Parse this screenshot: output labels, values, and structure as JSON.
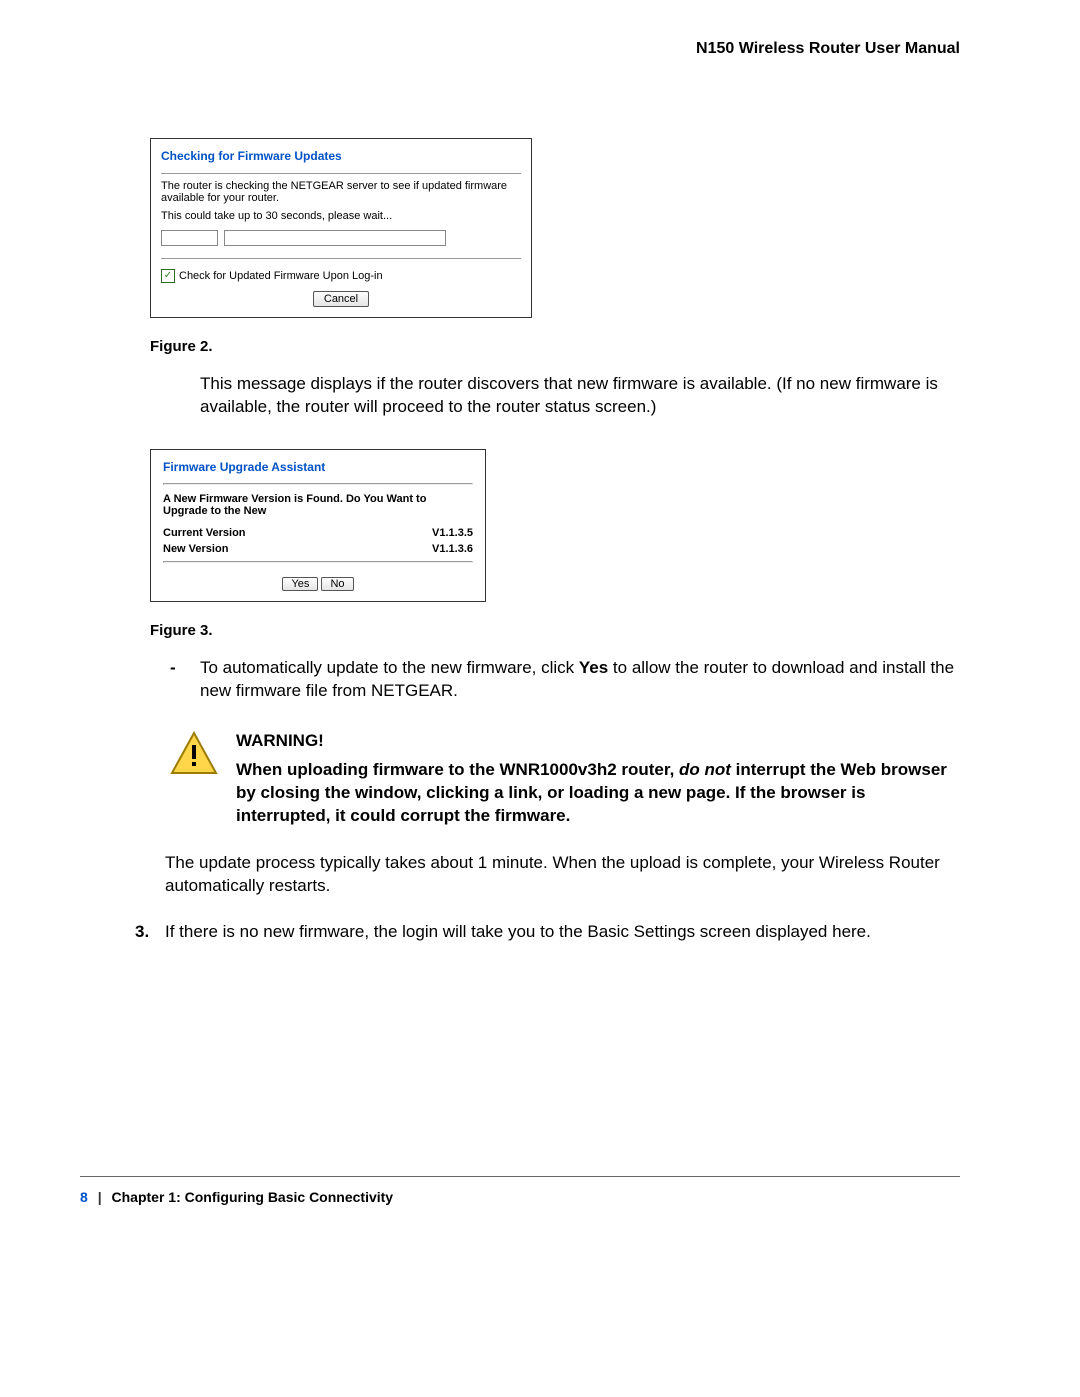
{
  "header": {
    "title": "N150 Wireless Router User Manual"
  },
  "figure2": {
    "panel_title": "Checking for Firmware Updates",
    "line1": "The router is checking the NETGEAR server to see if updated firmware available for your router.",
    "line2": "This could take up to 30 seconds, please wait...",
    "checkbox_label": "Check for Updated Firmware Upon Log-in",
    "cancel": "Cancel",
    "caption": "Figure 2."
  },
  "para1": "This message displays if the router discovers that new firmware is available. (If no new firmware is available, the router will proceed to the router status screen.)",
  "figure3": {
    "panel_title": "Firmware Upgrade Assistant",
    "question": "A New Firmware Version is Found. Do You Want to Upgrade to the New",
    "current_label": "Current Version",
    "current_value": "V1.1.3.5",
    "new_label": "New Version",
    "new_value": "V1.1.3.6",
    "yes": "Yes",
    "no": "No",
    "caption": "Figure 3."
  },
  "bullet": {
    "dash": "-",
    "text_before": "To automatically update to the new firmware, click ",
    "yes_word": "Yes",
    "text_after": " to allow the router to download and install the new firmware file from NETGEAR."
  },
  "warning": {
    "heading": "WARNING!",
    "part1": "When uploading firmware to the WNR1000v3h2 router, ",
    "italic": "do not",
    "part2": " interrupt the Web browser by closing the window, clicking a link, or loading a new page. If the browser is interrupted, it could corrupt the firmware."
  },
  "para2": "The update process typically takes about 1 minute. When the upload is complete, your Wireless Router automatically restarts.",
  "step3": {
    "num": "3.",
    "text": "If there is no new firmware, the login will take you to the Basic Settings screen displayed here."
  },
  "footer": {
    "page": "8",
    "chapter": "Chapter 1:  Configuring Basic Connectivity"
  }
}
